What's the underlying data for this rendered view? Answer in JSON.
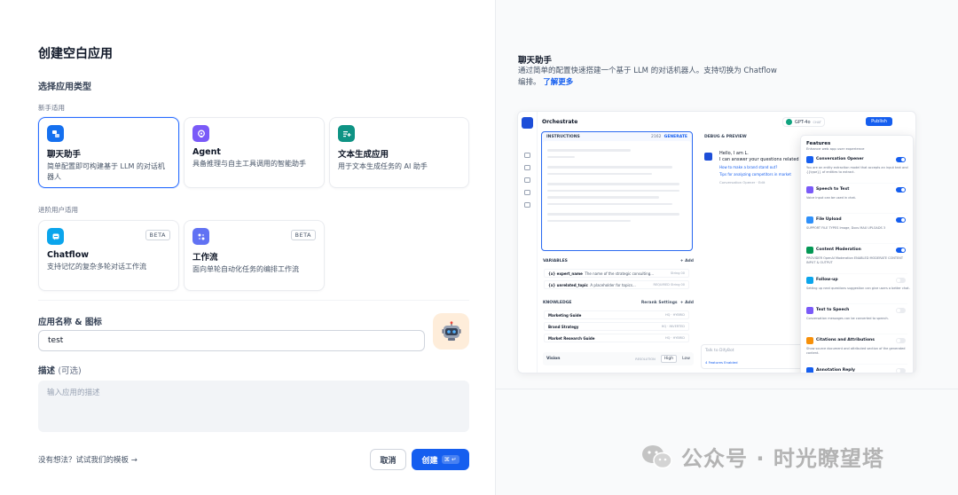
{
  "dialog": {
    "title": "创建空白应用",
    "type_section_title": "选择应用类型",
    "beginner_label": "新手适用",
    "advanced_label": "进阶用户适用",
    "beginner_cards": [
      {
        "title": "聊天助手",
        "desc": "简单配置即可构建基于 LLM 的对话机器人",
        "icon": "chat-bot-icon",
        "color": "#1570EF",
        "selected": true
      },
      {
        "title": "Agent",
        "desc": "具备推理与自主工具调用的智能助手",
        "icon": "agent-icon",
        "color": "#7A5AF8",
        "selected": false
      },
      {
        "title": "文本生成应用",
        "desc": "用于文本生成任务的 AI 助手",
        "icon": "text-generation-icon",
        "color": "#0E9384",
        "selected": false
      }
    ],
    "advanced_cards": [
      {
        "title": "Chatflow",
        "desc": "支持记忆的复杂多轮对话工作流",
        "icon": "chatflow-icon",
        "color": "#0BA5EC",
        "badge": "BETA"
      },
      {
        "title": "工作流",
        "desc": "面向单轮自动化任务的编排工作流",
        "icon": "workflow-icon",
        "color": "#6172F3",
        "badge": "BETA"
      }
    ],
    "name_label": "应用名称 & 图标",
    "name_value": "test",
    "app_icon": "robot-emoji-icon",
    "desc_label": "描述",
    "desc_optional": "(可选)",
    "desc_placeholder": "输入应用的描述",
    "template_link": "没有想法？试试我们的模板 →",
    "cancel_label": "取消",
    "create_label": "创建",
    "create_shortcut": "⌘ ↵",
    "accent_color": "#155EEF"
  },
  "preview": {
    "title": "聊天助手",
    "desc": "通过简单的配置快速搭建一个基于 LLM 的对话机器人。支持切换为 Chatflow 编排。",
    "learn_more": "了解更多",
    "mock": {
      "orchestrate": "Orchestrate",
      "model": "GPT-4o",
      "model_tag": "CHAT",
      "publish": "Publish",
      "instructions": "INSTRUCTIONS",
      "instr_count": "2162",
      "generate": "GENERATE",
      "variables": "VARIABLES",
      "add": "+ Add",
      "variable_rows": [
        {
          "name": "{x} expert_name",
          "desc": "The name of the strategic consulting...",
          "type": "String 00"
        },
        {
          "name": "{x} unrelated_topic",
          "desc": "A placeholder for topics...",
          "type": "REQUIRED  String 00"
        }
      ],
      "knowledge": "KNOWLEDGE",
      "rerank": "Rerank Settings",
      "knowledge_rows": [
        {
          "name": "Marketing Guide",
          "tag": "HQ · HYBRID"
        },
        {
          "name": "Brand Strategy",
          "tag": "HQ · INVERTED"
        },
        {
          "name": "Market Research Guide",
          "tag": "HQ · HYBRID"
        }
      ],
      "vision": "Vision",
      "resolution": "RESOLUTION",
      "high": "High",
      "low": "Low",
      "debug": "DEBUG & PREVIEW",
      "chat_greeting": "Hello, I am L.",
      "chat_line2": "I can answer your questions related",
      "chat_q1": "How to make a brand stand out?",
      "chat_q2": "Tips for analyzing competitors in market",
      "chat_opener": "Conversation Opener · Edit",
      "talk_placeholder": "Talk to DifyBot",
      "features_enabled": "4 Features Enabled",
      "features_title": "Features",
      "features_sub": "Enhance web app user experience",
      "features": [
        {
          "name": "Conversation Opener",
          "desc": "You are an entity extraction model that accepts an input text and {{type}} of entities to extract.",
          "color": "#155EEF",
          "on": true
        },
        {
          "name": "Speech to Text",
          "desc": "Voice input can be used in chat.",
          "color": "#7A5AF8",
          "on": true
        },
        {
          "name": "File Upload",
          "desc": "SUPPORT FILE TYPES  Image, Docs   MAX UPLOADS 3",
          "color": "#2E90FA",
          "on": true
        },
        {
          "name": "Content Moderation",
          "desc": "PROVIDER OpenAI Moderation   ENABLED MODERATE CONTENT INPUT & OUTPUT",
          "color": "#039855",
          "on": true
        },
        {
          "name": "Follow-up",
          "desc": "Setting up next questions suggestion can give users a better chat.",
          "color": "#0BA5EC",
          "on": false
        },
        {
          "name": "Text to Speech",
          "desc": "Conversation messages can be converted to speech.",
          "color": "#7A5AF8",
          "on": false
        },
        {
          "name": "Citations and Attributions",
          "desc": "Show source document and attributed section of the generated content.",
          "color": "#F79009",
          "on": false
        },
        {
          "name": "Annotation Reply",
          "desc": "",
          "color": "#155EEF",
          "on": false
        }
      ]
    }
  },
  "watermark": "公众号 · 时光瞭望塔"
}
